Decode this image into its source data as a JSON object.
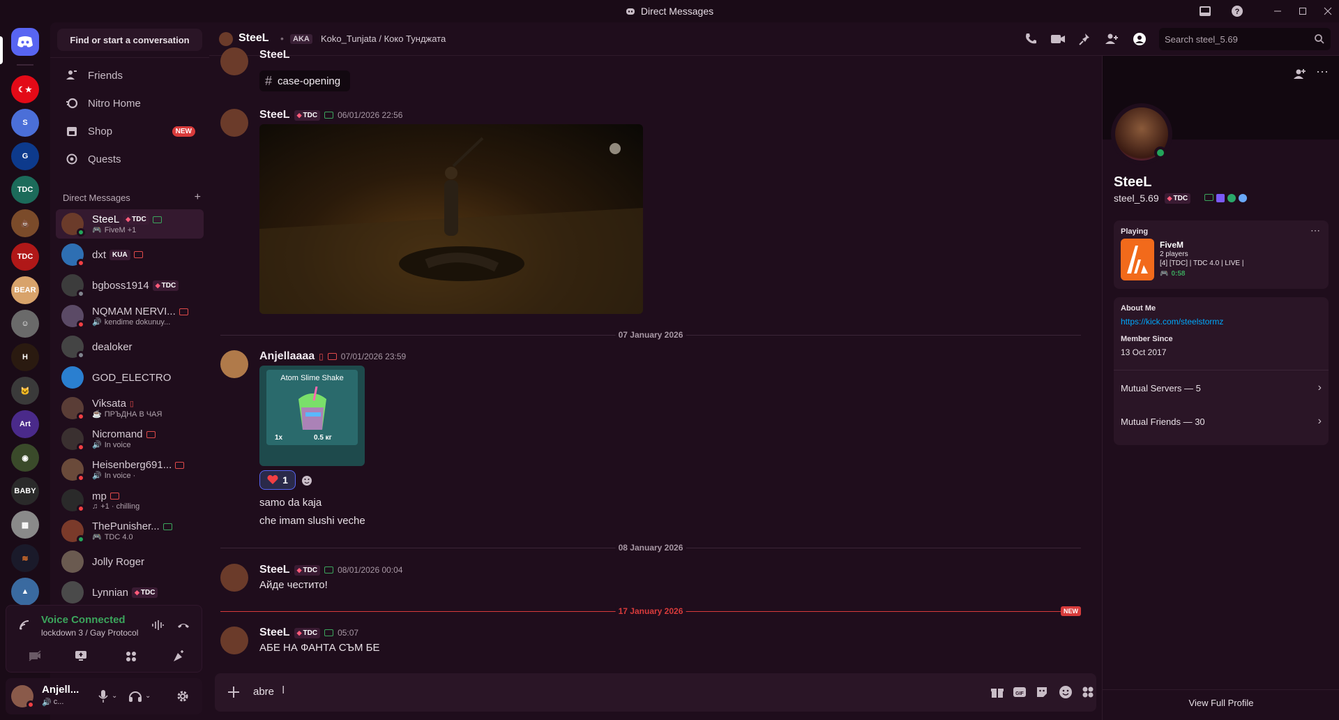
{
  "window": {
    "title": "Direct Messages"
  },
  "sidebar": {
    "find_label": "Find or start a conversation",
    "nav": [
      {
        "label": "Friends",
        "icon": "friends-icon"
      },
      {
        "label": "Nitro Home",
        "icon": "nitro-icon"
      },
      {
        "label": "Shop",
        "icon": "shop-icon",
        "badge": "NEW"
      },
      {
        "label": "Quests",
        "icon": "quests-icon"
      }
    ],
    "dm_header": "Direct Messages",
    "dms": [
      {
        "name": "SteeL",
        "tag": "TDC",
        "sub": "FiveM +1",
        "status": "online",
        "color": "#6b3b2a"
      },
      {
        "name": "dxt",
        "tag": "KUA",
        "sub": "",
        "status": "dnd",
        "color": "#2e6fb3"
      },
      {
        "name": "bgboss1914",
        "tag": "TDC",
        "sub": "",
        "status": "idle",
        "color": "#3c3c3c"
      },
      {
        "name": "NQMAM NERVI...",
        "tag": "",
        "sub": "kendime dokunuy...",
        "status": "dnd",
        "color": "#5b4a66"
      },
      {
        "name": "dealoker",
        "tag": "",
        "sub": "",
        "status": "offline",
        "color": "#444"
      },
      {
        "name": "GOD_ELECTRO",
        "tag": "",
        "sub": "",
        "status": "offline",
        "color": "#2a7fd0"
      },
      {
        "name": "Viksata",
        "tag": "",
        "sub": "ПРЪДНА В ЧАЯ",
        "status": "dnd",
        "color": "#5a3d36"
      },
      {
        "name": "Nicromand",
        "tag": "",
        "sub": "In voice",
        "status": "dnd",
        "color": "#3a3030"
      },
      {
        "name": "Heisenberg691...",
        "tag": "",
        "sub": "In voice ·",
        "status": "dnd",
        "color": "#6a4a3a"
      },
      {
        "name": "mp",
        "tag": "",
        "sub": "+1 · chilling",
        "status": "dnd",
        "color": "#2a2a2a"
      },
      {
        "name": "ThePunisher...",
        "tag": "",
        "sub": "TDC 4.0",
        "status": "online",
        "color": "#7a3a2a"
      },
      {
        "name": "Jolly Roger",
        "tag": "",
        "sub": "",
        "status": "offline",
        "color": "#6a5a50"
      },
      {
        "name": "Lynnian",
        "tag": "TDC",
        "sub": "",
        "status": "offline",
        "color": "#4a4a4a"
      }
    ],
    "voice": {
      "title": "Voice Connected",
      "channel": "lockdown 3 / Gay Protocol"
    },
    "user": {
      "name": "Anjell...",
      "sub": "c..."
    }
  },
  "header": {
    "name": "SteeL",
    "aka_label": "AKA",
    "aka": "Koko_Tunjata / Коко Тунджата",
    "search_placeholder": "Search steel_5.69"
  },
  "chat": {
    "top_partial": {
      "name": "SteeL",
      "channel_chip": "case-opening"
    },
    "messages": [
      {
        "name": "SteeL",
        "tag": "TDC",
        "time": "06/01/2026 22:56"
      },
      {
        "name": "Anjellaaaa",
        "time": "07/01/2026 23:59",
        "card_title": "Atom Slime Shake",
        "card_qty": "1x",
        "card_weight": "0.5 кг",
        "reaction_count": "1",
        "lines": [
          "samo da kaja",
          "che imam slushi veche"
        ]
      },
      {
        "name": "SteeL",
        "tag": "TDC",
        "time": "08/01/2026 00:04",
        "lines": [
          "Айде честито!"
        ]
      },
      {
        "name": "SteeL",
        "tag": "TDC",
        "time": "05:07",
        "lines": [
          "АБЕ НА ФАНТА СЪМ БЕ"
        ]
      }
    ],
    "dividers": [
      "07 January 2026",
      "08 January 2026",
      "17 January 2026"
    ],
    "new_badge": "NEW",
    "input_value": "abre"
  },
  "profile": {
    "display_name": "SteeL",
    "username": "steel_5.69",
    "tag": "TDC",
    "playing_label": "Playing",
    "game": "FiveM",
    "game_players": "2 players",
    "game_server": "[4] [TDC] | TDC 4.0 | LIVE |",
    "game_time": "0:58",
    "about_label": "About Me",
    "about_link": "https://kick.com/steelstormz",
    "member_since_label": "Member Since",
    "member_since": "13 Oct 2017",
    "mutual_servers": "Mutual Servers — 5",
    "mutual_friends": "Mutual Friends — 30",
    "view_full": "View Full Profile"
  },
  "colors": {
    "accent": "#5865f2",
    "danger": "#d83b3b",
    "online": "#23a55a",
    "link": "#00a8fc"
  }
}
